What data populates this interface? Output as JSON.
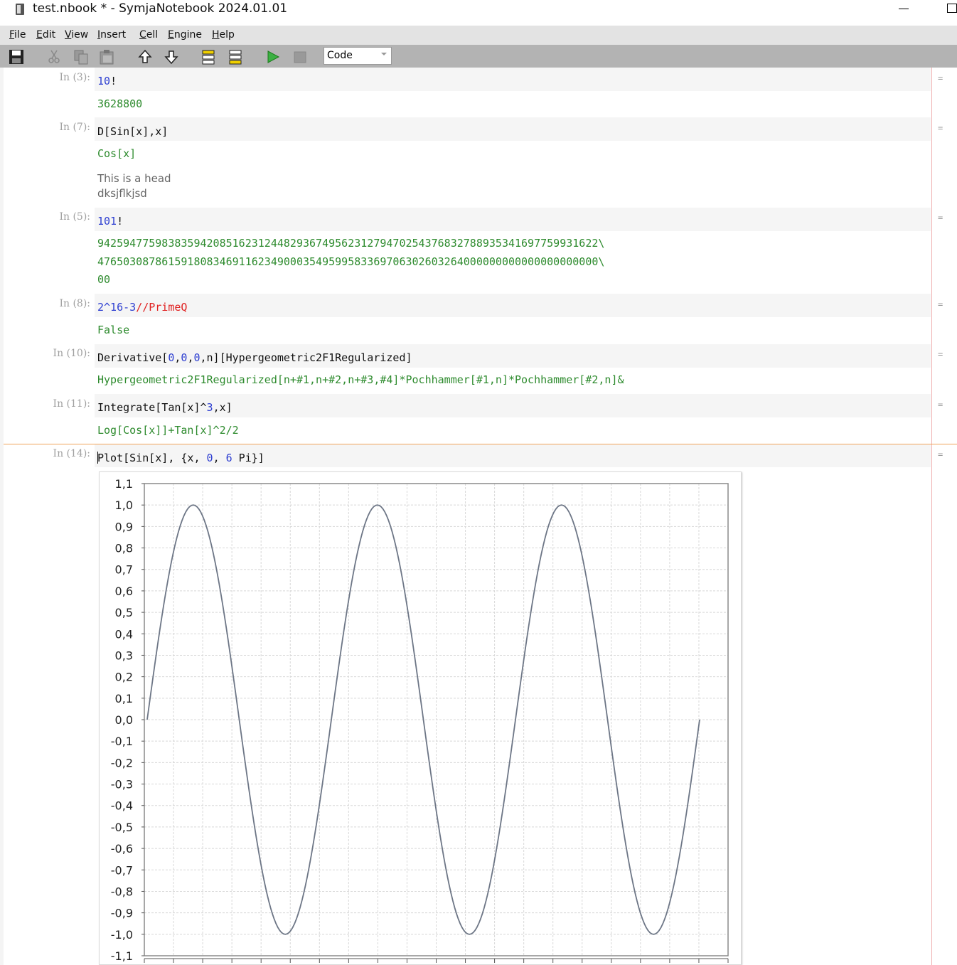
{
  "window": {
    "title": "test.nbook * - SymjaNotebook 2024.01.01"
  },
  "menu": [
    "File",
    "Edit",
    "View",
    "Insert",
    "Cell",
    "Engine",
    "Help"
  ],
  "menu_mnemonic": [
    "F",
    "E",
    "V",
    "I",
    "C",
    "E",
    "H"
  ],
  "toolbar": {
    "icons": [
      "save-icon",
      "cut-icon",
      "copy-icon",
      "paste-icon",
      "move-up-icon",
      "move-down-icon",
      "insert-cell-above-icon",
      "insert-cell-below-icon",
      "run-icon",
      "stop-icon"
    ],
    "mode": "Code"
  },
  "colors": {
    "input_blue": "#2e3fd1",
    "output_green": "#2e8b2e",
    "operator_red": "#e02020",
    "active_separator": "#f0a35a",
    "plot_line": "#6d7686"
  },
  "cells": [
    {
      "label": "In (3):",
      "input_parts": [
        {
          "t": "10",
          "c": "blue"
        },
        {
          "t": "!",
          "c": "black"
        }
      ],
      "output_lines": [
        "3628800"
      ]
    },
    {
      "label": "In (7):",
      "input_parts": [
        {
          "t": "D[Sin[x],x]",
          "c": "black"
        }
      ],
      "output_lines": [
        "Cos[x]"
      ],
      "text_lines": [
        "This is a head",
        "dksjflkjsd"
      ]
    },
    {
      "label": "In (5):",
      "input_parts": [
        {
          "t": "101",
          "c": "blue"
        },
        {
          "t": "!",
          "c": "black"
        }
      ],
      "output_lines": [
        "942594775983835942085162312448293674956231279470254376832788935341697759931622\\",
        "476503087861591808346911623490003549599583369706302603264000000000000000000000\\",
        "00"
      ]
    },
    {
      "label": "In (8):",
      "input_parts": [
        {
          "t": "2^16-3",
          "c": "blue"
        },
        {
          "t": "//PrimeQ",
          "c": "red"
        }
      ],
      "output_lines": [
        "False"
      ]
    },
    {
      "label": "In (10):",
      "input_parts": [
        {
          "t": "Derivative[",
          "c": "black"
        },
        {
          "t": "0",
          "c": "blue"
        },
        {
          "t": ",",
          "c": "black"
        },
        {
          "t": "0",
          "c": "blue"
        },
        {
          "t": ",",
          "c": "black"
        },
        {
          "t": "0",
          "c": "blue"
        },
        {
          "t": ",n][Hypergeometric2F1Regularized]",
          "c": "black"
        }
      ],
      "output_lines": [
        "Hypergeometric2F1Regularized[n+#1,n+#2,n+#3,#4]*Pochhammer[#1,n]*Pochhammer[#2,n]&"
      ]
    },
    {
      "label": "In (11):",
      "input_parts": [
        {
          "t": "Integrate[Tan[x]^",
          "c": "black"
        },
        {
          "t": "3",
          "c": "blue"
        },
        {
          "t": ",x]",
          "c": "black"
        }
      ],
      "output_lines": [
        "Log[Cos[x]]+Tan[x]^2/2"
      ]
    },
    {
      "label": "In (14):",
      "input_parts": [
        {
          "t": "Plot[Sin[x], {x, ",
          "c": "black"
        },
        {
          "t": "0",
          "c": "blue"
        },
        {
          "t": ", ",
          "c": "black"
        },
        {
          "t": "6",
          "c": "blue"
        },
        {
          "t": " Pi}]",
          "c": "black"
        }
      ],
      "active": true
    }
  ],
  "cell_marker": "=",
  "chart_data": {
    "type": "line",
    "function": "Sin[x]",
    "xlim": [
      0,
      18.849556
    ],
    "ylim": [
      -1.1,
      1.1
    ],
    "ytick_labels": [
      "1,1",
      "1,0",
      "0,9",
      "0,8",
      "0,7",
      "0,6",
      "0,5",
      "0,4",
      "0,3",
      "0,2",
      "0,1",
      "0,0",
      "-0,1",
      "-0,2",
      "-0,3",
      "-0,4",
      "-0,5",
      "-0,6",
      "-0,7",
      "-0,8",
      "-0,9",
      "-1,0",
      "-1,1"
    ],
    "ytick_values": [
      1.1,
      1.0,
      0.9,
      0.8,
      0.7,
      0.6,
      0.5,
      0.4,
      0.3,
      0.2,
      0.1,
      0.0,
      -0.1,
      -0.2,
      -0.3,
      -0.4,
      -0.5,
      -0.6,
      -0.7,
      -0.8,
      -0.9,
      -1.0,
      -1.1
    ],
    "grid": true,
    "series": [
      {
        "samples": 300
      }
    ]
  }
}
